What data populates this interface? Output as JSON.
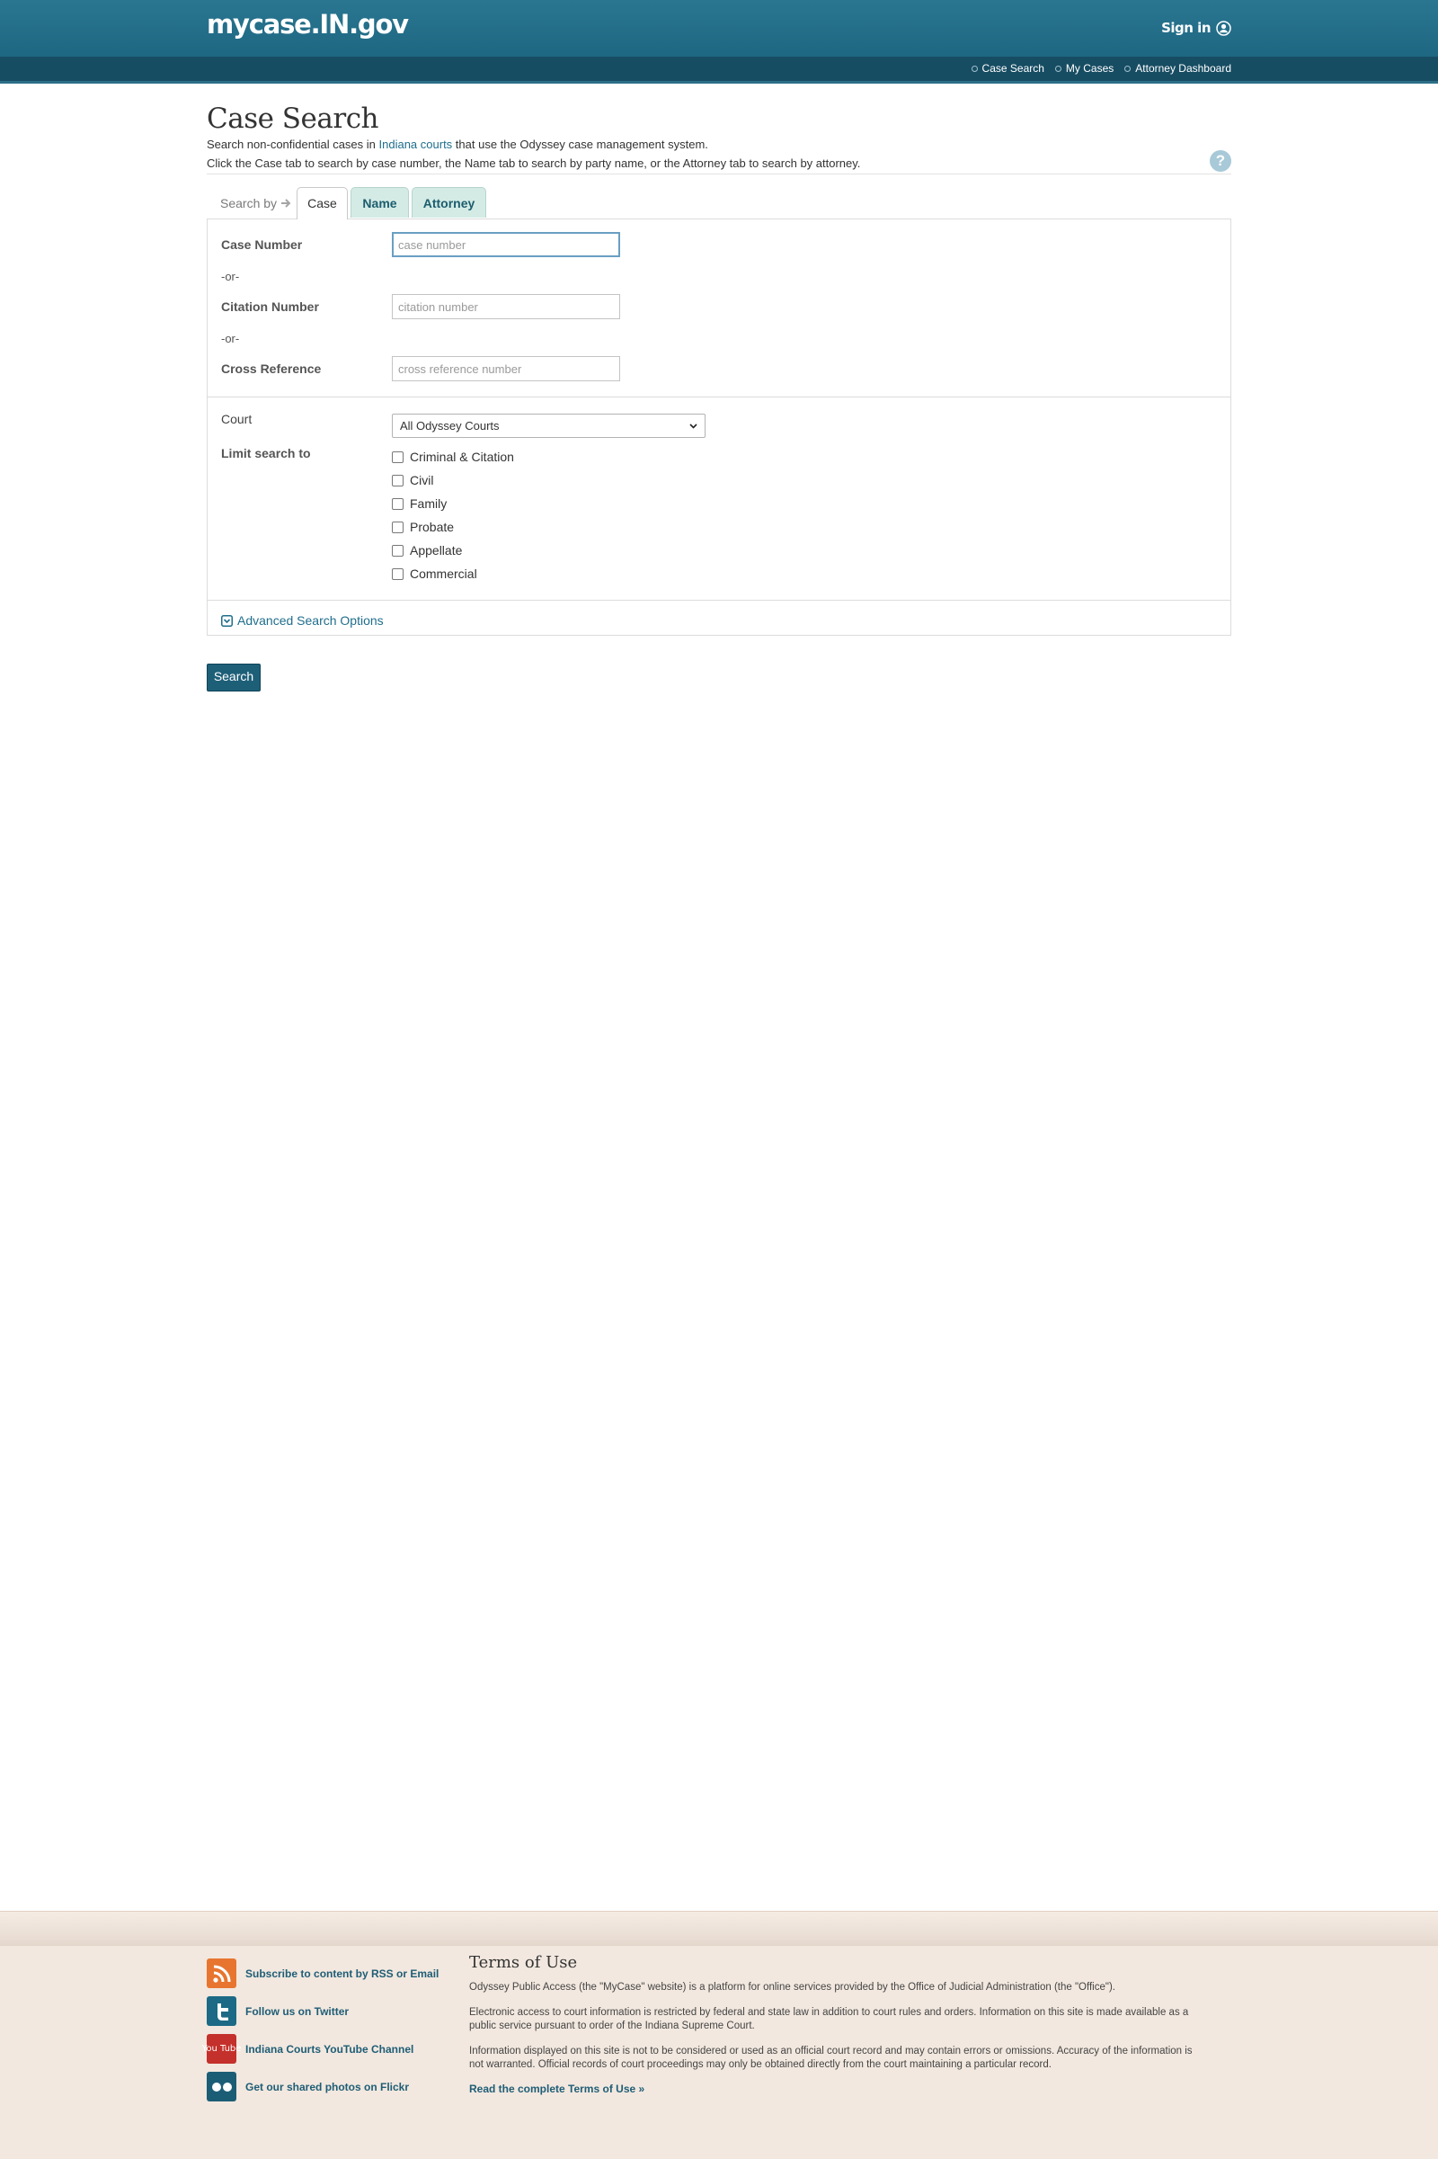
{
  "header": {
    "logo": "mycase.IN.gov",
    "sign_in": "Sign in",
    "nav": [
      "Case Search",
      "My Cases",
      "Attorney Dashboard"
    ]
  },
  "page": {
    "title": "Case Search",
    "intro_line1_a": "Search non-confidential cases in ",
    "intro_link": "Indiana courts",
    "intro_line1_b": " that use the Odyssey case management system.",
    "intro_line2": "Click the Case tab to search by case number, the Name tab to search by party name, or the Attorney tab to search by attorney.",
    "help_icon": "?"
  },
  "tabs": {
    "label": "Search by",
    "items": [
      "Case",
      "Name",
      "Attorney"
    ],
    "active": "Case"
  },
  "form": {
    "case_number_label": "Case Number",
    "case_number_placeholder": "case number",
    "or_text": "-or-",
    "citation_label": "Citation Number",
    "citation_placeholder": "citation number",
    "cross_ref_label": "Cross Reference",
    "cross_ref_placeholder": "cross reference number",
    "court_label": "Court",
    "court_selected": "All Odyssey Courts",
    "limit_label": "Limit search to",
    "limit_options": [
      "Criminal & Citation",
      "Civil",
      "Family",
      "Probate",
      "Appellate",
      "Commercial"
    ],
    "advanced_link": "Advanced Search Options",
    "search_button": "Search"
  },
  "footer": {
    "social": [
      {
        "label": "Subscribe to content by RSS or Email",
        "icon": "rss-icon",
        "color": "#e8752f"
      },
      {
        "label": "Follow us on Twitter",
        "icon": "twitter-icon",
        "color": "#1c6a85"
      },
      {
        "label": "Indiana Courts YouTube Channel",
        "icon": "youtube-icon",
        "color": "#c4302b"
      },
      {
        "label": "Get our shared photos on Flickr",
        "icon": "flickr-icon",
        "color": "#1c5d76"
      }
    ],
    "youtube_icon_text": "You Tube",
    "terms_title": "Terms of Use",
    "terms_p1": "Odyssey Public Access (the \"MyCase\" website) is a platform for online services provided by the Office of Judicial Administration (the \"Office\").",
    "terms_p2": "Electronic access to court information is restricted by federal and state law in addition to court rules and orders. Information on this site is made available as a public service pursuant to order of the Indiana Supreme Court.",
    "terms_p3": "Information displayed on this site is not to be considered or used as an official court record and may contain errors or omissions. Accuracy of the information is not warranted. Official records of court proceedings may only be obtained directly from the court maintaining a particular record.",
    "terms_link": "Read the complete Terms of Use »"
  }
}
